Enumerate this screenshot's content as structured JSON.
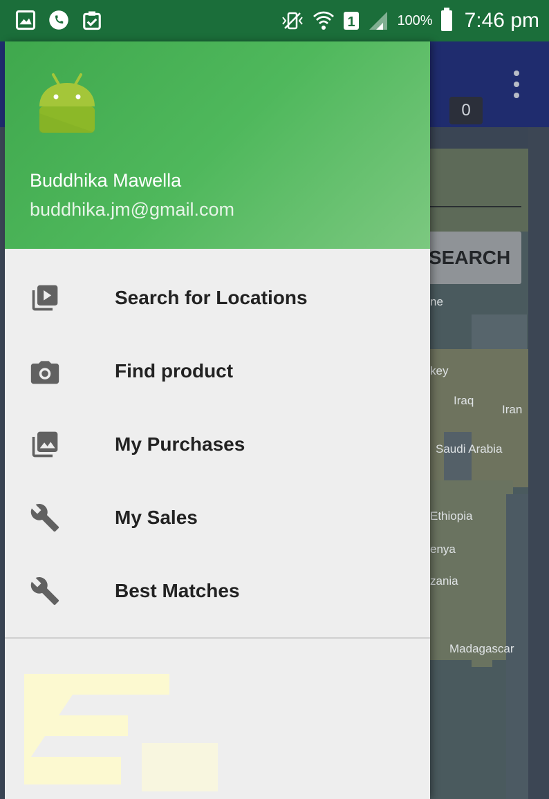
{
  "status_bar": {
    "battery_percent": "100%",
    "time": "7:46 pm",
    "left_icons": [
      "image-icon",
      "phone-icon",
      "clipboard-check-icon"
    ],
    "right_icons": [
      "vibrate-mute-icon",
      "wifi-icon",
      "sim-1-icon",
      "signal-icon",
      "battery-icon"
    ]
  },
  "toolbar": {
    "badge_count": "0"
  },
  "background": {
    "search_button_label": "SEARCH",
    "map_labels": [
      "ne",
      "key",
      "Iraq",
      "Iran",
      "Saudi Arabia",
      "Ethiopia",
      "enya",
      "zania",
      "Madagascar"
    ]
  },
  "drawer": {
    "header": {
      "user_name": "Buddhika Mawella",
      "user_email": "buddhika.jm@gmail.com",
      "avatar_icon": "android-icon",
      "header_color": "#4caf50"
    },
    "items": [
      {
        "label": "Search for Locations",
        "icon": "video-library-icon"
      },
      {
        "label": "Find product",
        "icon": "camera-icon"
      },
      {
        "label": "My Purchases",
        "icon": "photo-library-icon"
      },
      {
        "label": "My Sales",
        "icon": "wrench-icon"
      },
      {
        "label": "Best Matches",
        "icon": "wrench-icon"
      }
    ]
  },
  "colors": {
    "status_bar": "#1b6e3a",
    "drawer_bg": "#eeeeee",
    "toolbar_bg": "#1f2c6e",
    "icon_grey": "#616161"
  }
}
